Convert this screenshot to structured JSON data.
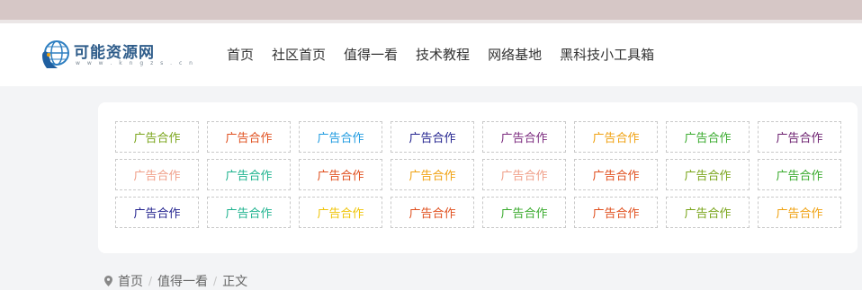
{
  "site": {
    "logo_text": "可能资源网",
    "logo_sub": "w w w . k n g z s . c n"
  },
  "nav": [
    "首页",
    "社区首页",
    "值得一看",
    "技术教程",
    "网络基地",
    "黑科技小工具箱"
  ],
  "ads": {
    "label": "广告合作",
    "colors": [
      "#7aa51b",
      "#e0501f",
      "#1f9be0",
      "#23238f",
      "#7b2a7e",
      "#f0a212",
      "#3aab2e",
      "#6b1e6e",
      "#f0a08a",
      "#1fb38f",
      "#e0501f",
      "#f0a212",
      "#f0a08a",
      "#e0501f",
      "#7aa51b",
      "#3aab2e",
      "#23238f",
      "#1fb38f",
      "#f0c50a",
      "#e0501f",
      "#3aab2e",
      "#e0501f",
      "#7aa51b",
      "#f0a212"
    ]
  },
  "breadcrumb": {
    "icon": "location-pin-icon",
    "home": "首页",
    "separator": "/",
    "section": "值得一看",
    "current": "正文"
  },
  "colors": {
    "topbar": "#d6c7c6",
    "page_bg": "#f3f4f6",
    "logo_blue": "#2e5c8a"
  }
}
